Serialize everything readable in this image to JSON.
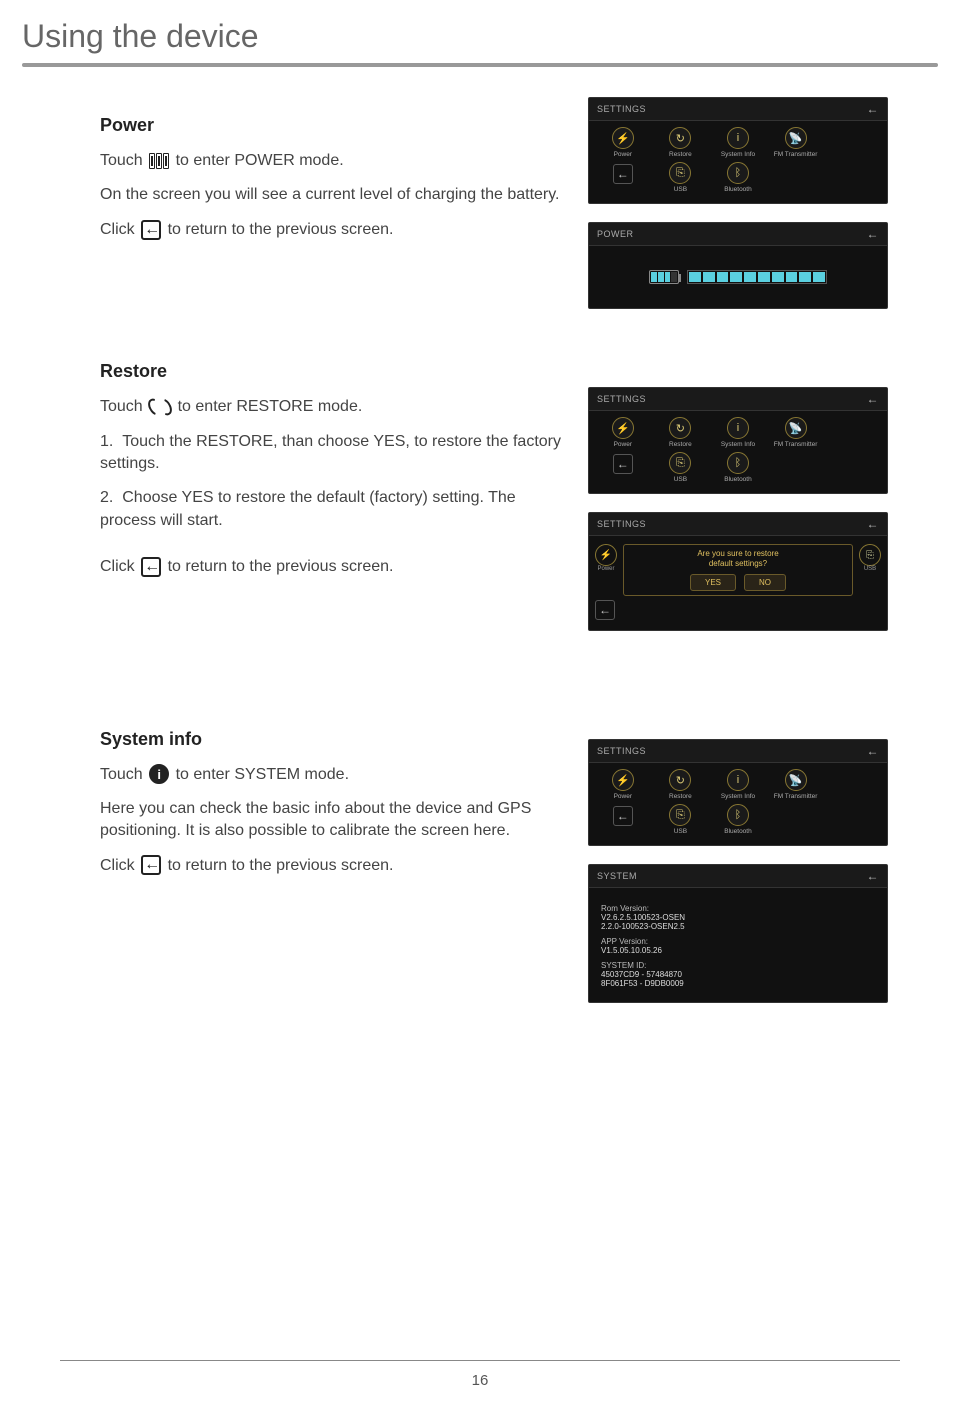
{
  "page": {
    "title": "Using the device",
    "number": "16"
  },
  "sections": {
    "power": {
      "heading": "Power",
      "touch_pre": "Touch",
      "touch_post": "to enter POWER mode.",
      "desc": "On the screen you will see a current level of charging the battery.",
      "click_pre": "Click",
      "click_post": "to return to the previous screen."
    },
    "restore": {
      "heading": "Restore",
      "touch_pre": "Touch",
      "touch_post": "to enter RESTORE mode.",
      "step1": "Touch the RESTORE, than choose YES, to restore the factory settings.",
      "step2": "Choose YES to restore the default (factory) setting. The process will start.",
      "click_pre": "Click",
      "click_post": "to return to the previous screen."
    },
    "sysinfo": {
      "heading": "System info",
      "touch_pre": "Touch",
      "touch_post": "to enter SYSTEM mode.",
      "desc": "Here you can check the basic info about the device and GPS positioning. It is also possible to calibrate the screen here.",
      "click_pre": "Click",
      "click_post": "to return to the previous screen."
    }
  },
  "screenshots": {
    "settings_header": "SETTINGS",
    "power_header": "POWER",
    "system_header": "SYSTEM",
    "back_glyph": "←",
    "grid": {
      "power": "Power",
      "restore": "Restore",
      "sysinfo": "System Info",
      "fm": "FM Transmitter",
      "usb": "USB",
      "bluetooth": "Bluetooth"
    },
    "restore_dialog": {
      "text1": "Are you sure to restore",
      "text2": "default settings?",
      "yes": "YES",
      "no": "NO",
      "left_label": "Power",
      "right_label": "USB"
    },
    "sysinfo_panel": {
      "rom_label": "Rom Version:",
      "rom_v1": "V2.6.2.5.100523-OSEN",
      "rom_v2": "2.2.0-100523-OSEN2.5",
      "app_label": "APP Version:",
      "app_v": "V1.5.05.10.05.26",
      "sys_label": "SYSTEM ID:",
      "sys_v1": "45037CD9 - 57484870",
      "sys_v2": "8F061F53 - D9DB0009"
    }
  }
}
